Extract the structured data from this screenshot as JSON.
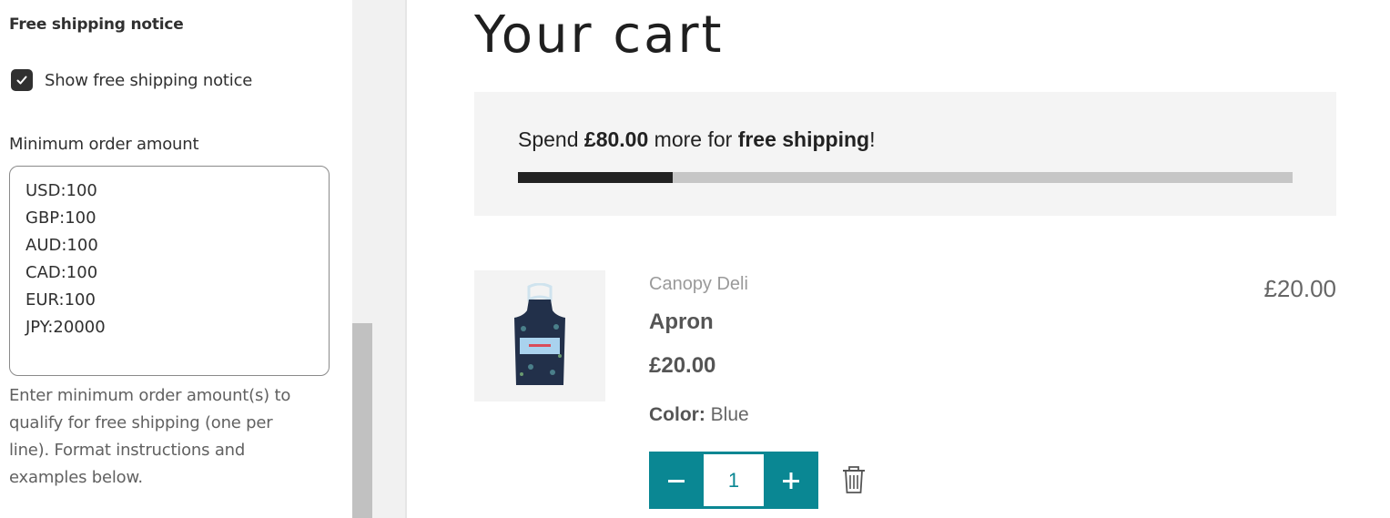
{
  "settings": {
    "section_title": "Free shipping notice",
    "checkbox_label": "Show free shipping notice",
    "checkbox_checked": true,
    "field_label": "Minimum order amount",
    "textarea_value": "USD:100\nGBP:100\nAUD:100\nCAD:100\nEUR:100\nJPY:20000",
    "help_text": "Enter minimum order amount(s) to qualify for free shipping (one per line). Format instructions and examples below."
  },
  "cart": {
    "title": "Your cart",
    "shipping": {
      "prefix": "Spend ",
      "amount": "£80.00",
      "middle": " more for ",
      "emphasis": "free shipping",
      "suffix": "!",
      "progress_percent": 20
    },
    "item": {
      "vendor": "Canopy Deli",
      "name": "Apron",
      "unit_price": "£20.00",
      "line_price": "£20.00",
      "variant_key": "Color:",
      "variant_value": "Blue",
      "quantity": "1",
      "image_icon": "apron-image"
    },
    "qty_decrement_icon": "minus-icon",
    "qty_increment_icon": "plus-icon",
    "remove_icon": "trash-icon"
  },
  "colors": {
    "accent": "#0a8793",
    "progress_fill": "#222222",
    "progress_track": "#c6c6c6"
  }
}
